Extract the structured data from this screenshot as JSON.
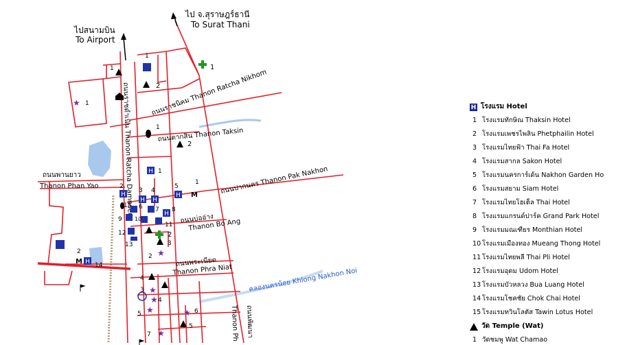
{
  "map": {
    "top_label": {
      "thai": "ไป จ.สุราษฎร์ธานี",
      "english": "To Surat Thani"
    },
    "airport_label": {
      "thai": "ไปสนามบิน",
      "english": "To Airport"
    },
    "street_labels": [
      {
        "text": "ถนนราชดำเนิน Thanon Ratcha Damnoen",
        "thai": "ถนนราชดำเนิน",
        "english": "Thanon Ratcha Damnoen"
      },
      {
        "text": "ถนนราชนิคม Thanon Ratcha Nikhom",
        "thai": "ถนนราชนิคม",
        "english": "Thanon Ratcha Nikhom"
      },
      {
        "text": "ถนนตากสิน Thanon Taksin",
        "thai": "ถนนตากสิน",
        "english": "Thanon Taksin"
      },
      {
        "text": "ถนนพานยาว",
        "english": "Thanon Phan Yao"
      },
      {
        "text": "ถนนปากนคร Thanon Pak Nakhon",
        "thai": "ถนนปากนคร",
        "english": "Thanon Pak Nakhon"
      },
      {
        "text": "ถนนบ่ออ่าง",
        "english": "Thanon Bo Ang"
      },
      {
        "text": "ถนนพระเนียด",
        "english": "Thanon Phra Niat"
      },
      {
        "text": "Thanon Ph",
        "thai": "ถนนพัฒนา"
      }
    ],
    "canal_label": "คลองนครน้อย Khlong Nakhon Noi",
    "hotel_numbers": [
      "1",
      "2",
      "3",
      "4",
      "5",
      "6",
      "7",
      "8",
      "9",
      "10",
      "11",
      "12",
      "13",
      "14",
      "15"
    ],
    "temple_numbers": [
      "1",
      "2",
      "3",
      "4",
      "5",
      "6",
      "7"
    ],
    "hospital_numbers": [
      "1",
      "2"
    ],
    "museum_numbers": [
      "1",
      "2"
    ],
    "star_numbers": [
      "1",
      "2",
      "3",
      "4",
      "5",
      "6"
    ],
    "other_numbers": [
      "1",
      "2",
      "3",
      "4",
      "5"
    ],
    "colors": {
      "road": "#e0202a",
      "water": "#a8c8ee",
      "hotel": "#2233aa",
      "hospital": "#1a9a1a",
      "star": "#7a2e9e",
      "river_label": "#2a5bd0",
      "railway": "#b79a76"
    }
  },
  "legend": {
    "hotel_heading": "โรงแรม Hotel",
    "hotels": [
      {
        "num": "1",
        "name": "โรงแรมทักษิณ Thaksin Hotel"
      },
      {
        "num": "2",
        "name": "โรงแรมเพชรไพลิน Phetphailin Hotel"
      },
      {
        "num": "3",
        "name": "โรงแรมไทยฟ้า Thai Fa Hotel"
      },
      {
        "num": "4",
        "name": "โรงแรมสากล Sakon Hotel"
      },
      {
        "num": "5",
        "name": "โรงแรมนครการ์เด้น Nakhon Garden Ho"
      },
      {
        "num": "6",
        "name": "โรงแรมสยาม Siam Hotel"
      },
      {
        "num": "7",
        "name": "โรงแรมไทยโฮเต็ล Thai Hotel"
      },
      {
        "num": "8",
        "name": "โรงแรมแกรนด์ปาร์ค Grand Park Hotel"
      },
      {
        "num": "9",
        "name": "โรงแรมมณเฑียร Monthian Hotel"
      },
      {
        "num": "10",
        "name": "โรงแรมเมืองทอง Mueang Thong Hotel"
      },
      {
        "num": "11",
        "name": "โรงแรมไทยพลี Thai Pli Hotel"
      },
      {
        "num": "12",
        "name": "โรงแรมอุดม Udom Hotel"
      },
      {
        "num": "13",
        "name": "โรงแรมบัวหลวง Bua Luang Hotel"
      },
      {
        "num": "14",
        "name": "โรงแรมโชคชัย Chok Chai Hotel"
      },
      {
        "num": "15",
        "name": "โรงแรมทวินโลตัส Tawin Lotus Hotel"
      }
    ],
    "temple_heading": "วัด Temple (Wat)",
    "temple_first": "วัดชมพู Wat Chamao"
  }
}
